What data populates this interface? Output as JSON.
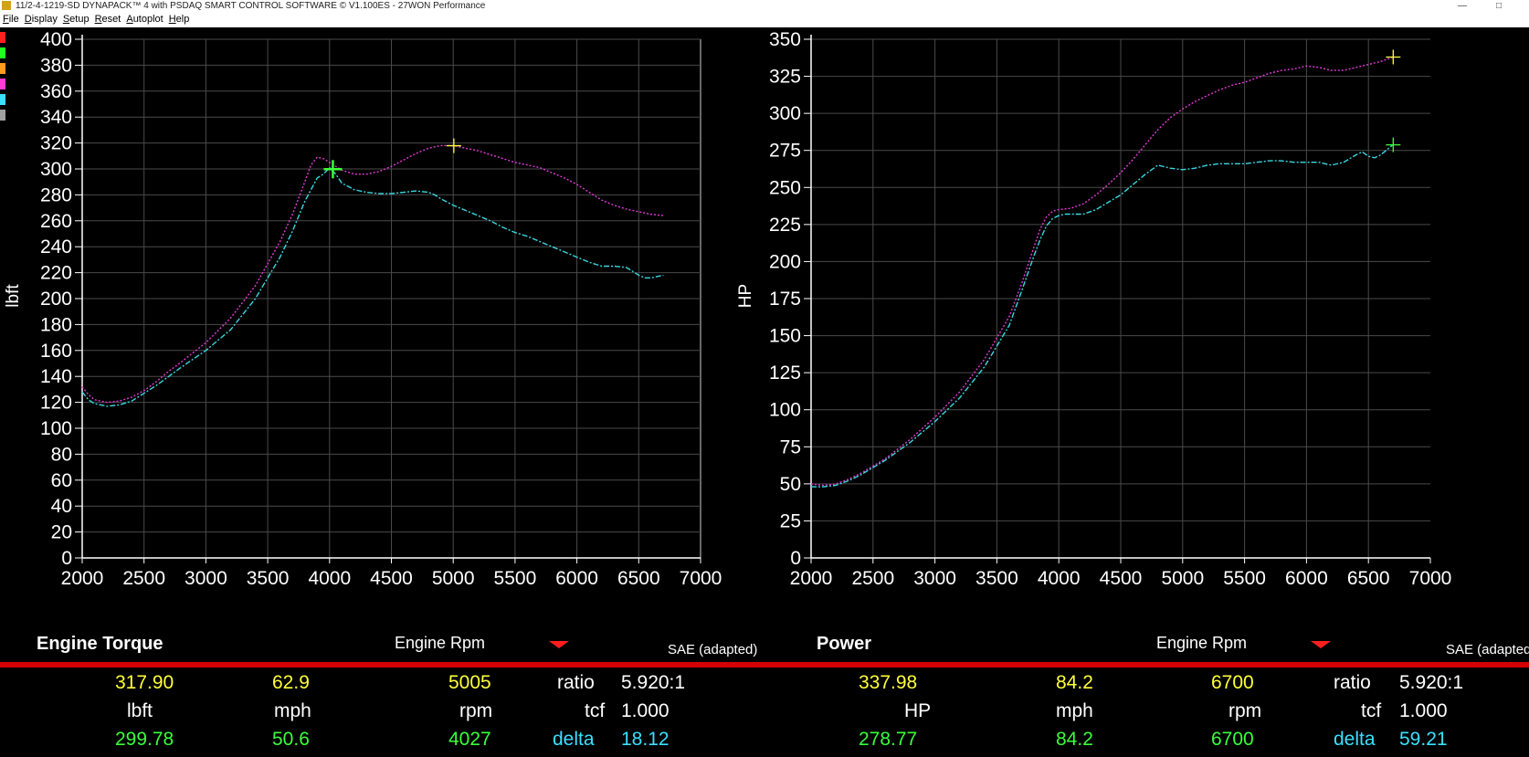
{
  "window": {
    "title": "11/2-4-1219-SD DYNAPACK™ 4 with PSDAQ SMART CONTROL SOFTWARE © V1.100ES - 27WON Performance"
  },
  "menu": [
    "File",
    "Display",
    "Setup",
    "Reset",
    "Autoplot",
    "Help"
  ],
  "colors": {
    "run1": "#e33ad6",
    "run2": "#3ad6e0",
    "grid": "#4a4a4a",
    "accent": "#d40000",
    "swatches": [
      "#ff2020",
      "#20ff20",
      "#ff9a1a",
      "#ff3ad6",
      "#3ae0ff",
      "#a0a0a0"
    ]
  },
  "chart_data": [
    {
      "type": "line",
      "title": "Engine Torque",
      "xlabel": "Engine Rpm",
      "ylabel": "lbft",
      "correction": "SAE (adapted)",
      "xlim": [
        2000,
        7000
      ],
      "ylim": [
        0,
        400
      ],
      "xticks": [
        "2000",
        "2500",
        "3000",
        "3500",
        "4000",
        "4500",
        "5000",
        "5500",
        "6000",
        "6500",
        "7000"
      ],
      "yticks": [
        "0",
        "20",
        "40",
        "60",
        "80",
        "100",
        "120",
        "140",
        "160",
        "180",
        "200",
        "220",
        "240",
        "260",
        "280",
        "300",
        "320",
        "340",
        "360",
        "380",
        "400"
      ],
      "grid": true,
      "series": [
        {
          "color": "#e33ad6",
          "x": [
            2000,
            2050,
            2100,
            2200,
            2300,
            2400,
            2500,
            2600,
            2700,
            2800,
            3000,
            3200,
            3400,
            3600,
            3700,
            3800,
            3850,
            3900,
            3950,
            4000,
            4050,
            4100,
            4200,
            4300,
            4400,
            4500,
            4600,
            4700,
            4800,
            4900,
            5000,
            5100,
            5200,
            5300,
            5400,
            5500,
            5600,
            5700,
            5800,
            5900,
            6000,
            6100,
            6200,
            6300,
            6400,
            6500,
            6600,
            6700
          ],
          "y": [
            132,
            126,
            122,
            120,
            121,
            124,
            129,
            136,
            144,
            151,
            166,
            185,
            210,
            244,
            265,
            290,
            303,
            309,
            308,
            305,
            302,
            299,
            296,
            296,
            298,
            302,
            307,
            312,
            316,
            318,
            318,
            316,
            314,
            311,
            308,
            305,
            303,
            301,
            297,
            293,
            288,
            282,
            276,
            272,
            269,
            267,
            265,
            264
          ]
        },
        {
          "color": "#3ad6e0",
          "x": [
            2000,
            2050,
            2100,
            2200,
            2300,
            2400,
            2500,
            2600,
            2700,
            2800,
            3000,
            3200,
            3400,
            3600,
            3700,
            3800,
            3900,
            3950,
            4000,
            4050,
            4100,
            4200,
            4300,
            4400,
            4500,
            4600,
            4700,
            4800,
            4850,
            4900,
            5000,
            5100,
            5200,
            5300,
            5400,
            5500,
            5600,
            5700,
            5800,
            5900,
            6000,
            6100,
            6200,
            6300,
            6400,
            6500,
            6550,
            6600,
            6700
          ],
          "y": [
            128,
            122,
            119,
            117,
            118,
            121,
            127,
            133,
            140,
            147,
            160,
            176,
            200,
            232,
            252,
            275,
            293,
            296,
            301,
            296,
            289,
            284,
            282,
            281,
            281,
            282,
            283,
            282,
            280,
            277,
            272,
            268,
            264,
            260,
            255,
            251,
            248,
            244,
            240,
            236,
            232,
            228,
            225,
            225,
            224,
            218,
            216,
            216,
            218
          ]
        }
      ],
      "markers": [
        {
          "x": 5005,
          "y": 317.9,
          "color": "#ffff3a"
        },
        {
          "x": 4027,
          "y": 299.78,
          "color": "#3aff3a"
        }
      ],
      "readout": {
        "run1": {
          "value": "317.90",
          "mph": "62.9",
          "rpm": "5005"
        },
        "units": {
          "value": "lbft",
          "mph": "mph",
          "rpm": "rpm"
        },
        "run2": {
          "value": "299.78",
          "mph": "50.6",
          "rpm": "4027"
        },
        "ratio_label": "ratio",
        "ratio": "5.920:1",
        "tcf_label": "tcf",
        "tcf": "1.000",
        "delta_label": "delta",
        "delta": "18.12"
      }
    },
    {
      "type": "line",
      "title": "Power",
      "xlabel": "Engine Rpm",
      "ylabel": "HP",
      "correction": "SAE (adapted)",
      "xlim": [
        2000,
        7000
      ],
      "ylim": [
        0,
        350
      ],
      "xticks": [
        "2000",
        "2500",
        "3000",
        "3500",
        "4000",
        "4500",
        "5000",
        "5500",
        "6000",
        "6500",
        "7000"
      ],
      "yticks": [
        "0",
        "25",
        "50",
        "75",
        "100",
        "125",
        "150",
        "175",
        "200",
        "225",
        "250",
        "275",
        "300",
        "325",
        "350"
      ],
      "grid": true,
      "series": [
        {
          "color": "#e33ad6",
          "x": [
            2000,
            2100,
            2200,
            2300,
            2400,
            2500,
            2600,
            2800,
            3000,
            3200,
            3400,
            3600,
            3700,
            3800,
            3850,
            3900,
            3950,
            4000,
            4100,
            4200,
            4300,
            4400,
            4500,
            4600,
            4700,
            4800,
            4900,
            5000,
            5100,
            5200,
            5300,
            5400,
            5500,
            5600,
            5700,
            5800,
            5900,
            6000,
            6100,
            6200,
            6300,
            6400,
            6500,
            6600,
            6700
          ],
          "y": [
            50,
            49,
            50,
            53,
            57,
            62,
            67,
            80,
            95,
            112,
            134,
            163,
            185,
            210,
            222,
            230,
            234,
            235,
            236,
            239,
            245,
            252,
            260,
            269,
            279,
            289,
            297,
            303,
            308,
            312,
            316,
            319,
            321,
            324,
            327,
            329,
            330,
            332,
            331,
            329,
            329,
            331,
            333,
            335,
            338
          ]
        },
        {
          "color": "#3ad6e0",
          "x": [
            2000,
            2100,
            2200,
            2300,
            2400,
            2500,
            2600,
            2800,
            3000,
            3200,
            3400,
            3600,
            3700,
            3800,
            3850,
            3900,
            3950,
            4000,
            4050,
            4100,
            4200,
            4300,
            4400,
            4500,
            4600,
            4700,
            4800,
            4900,
            5000,
            5100,
            5200,
            5300,
            5400,
            5500,
            5600,
            5700,
            5800,
            5900,
            6000,
            6100,
            6200,
            6300,
            6400,
            6450,
            6500,
            6550,
            6600,
            6700
          ],
          "y": [
            48,
            48,
            49,
            52,
            56,
            61,
            66,
            78,
            92,
            108,
            129,
            157,
            180,
            204,
            215,
            224,
            229,
            231,
            232,
            232,
            232,
            235,
            240,
            245,
            252,
            259,
            265,
            263,
            262,
            263,
            265,
            266,
            266,
            266,
            267,
            268,
            268,
            267,
            267,
            267,
            265,
            267,
            272,
            274,
            271,
            270,
            272,
            279
          ]
        }
      ],
      "markers": [
        {
          "x": 6700,
          "y": 337.98,
          "color": "#ffff3a"
        },
        {
          "x": 6700,
          "y": 278.77,
          "color": "#3aff3a"
        }
      ],
      "readout": {
        "run1": {
          "value": "337.98",
          "mph": "84.2",
          "rpm": "6700"
        },
        "units": {
          "value": "HP",
          "mph": "mph",
          "rpm": "rpm"
        },
        "run2": {
          "value": "278.77",
          "mph": "84.2",
          "rpm": "6700"
        },
        "ratio_label": "ratio",
        "ratio": "5.920:1",
        "tcf_label": "tcf",
        "tcf": "1.000",
        "delta_label": "delta",
        "delta": "59.21"
      }
    }
  ]
}
